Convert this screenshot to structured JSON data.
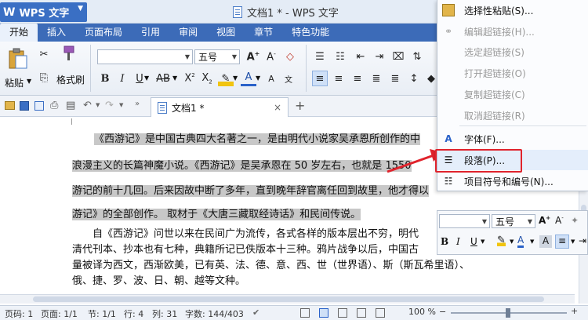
{
  "app": {
    "name": "WPS 文字",
    "doc_title": "文档1 * - WPS 文字"
  },
  "tabs": [
    "开始",
    "插入",
    "页面布局",
    "引用",
    "审阅",
    "视图",
    "章节",
    "特色功能"
  ],
  "ribbon": {
    "paste_label": "粘贴",
    "format_painter_label": "格式刷",
    "font_name": "",
    "font_size": "五号"
  },
  "doc_tab": {
    "label": "文档1 *"
  },
  "document": {
    "lines": [
      "《西游记》是中国古典四大名著之一，是由明代小说家吴承恩所创作的中",
      "浪漫主义的长篇神魔小说。《西游记》是吴承恩在 50 岁左右，也就是 1550",
      "游记的前十几回。后来因故中断了多年，直到晚年辞官离任回到故里，他才得以",
      "游记》的全部创作。 取材于《大唐三藏取经诗话》和民间传说。",
      "自《西游记》问世以来在民间广为流传，各式各样的版本层出不穷，明代",
      "清代刊本、抄本也有七种，典籍所记已佚版本十三种。鸦片战争以后，中国古",
      "量被译为西文，西渐欧美，已有英、法、德、意、西、世（世界语）、斯（斯瓦希里语）、",
      "俄、捷、罗、波、日、朝、越等文种。"
    ]
  },
  "context_menu": {
    "items": [
      {
        "label": "选择性粘贴(S)...",
        "disabled": false
      },
      {
        "label": "编辑超链接(H)...",
        "disabled": true
      },
      {
        "label": "选定超链接(S)",
        "disabled": true
      },
      {
        "label": "打开超链接(O)",
        "disabled": true
      },
      {
        "label": "复制超链接(C)",
        "disabled": true
      },
      {
        "label": "取消超链接(R)",
        "disabled": true
      },
      {
        "label": "字体(F)...",
        "disabled": false
      },
      {
        "label": "段落(P)...",
        "disabled": false
      },
      {
        "label": "项目符号和编号(N)...",
        "disabled": false
      }
    ]
  },
  "mini_toolbar": {
    "font_name": "",
    "font_size": "五号"
  },
  "status": {
    "page_num": "页码: 1",
    "pages": "页面: 1/1",
    "section": "节: 1/1",
    "row": "行: 4",
    "col": "列: 31",
    "words": "字数: 144/403",
    "zoom": "100 %"
  },
  "colors": {
    "tab_bar": "#3c6bb8",
    "app_button": "#3a6fc4",
    "highlight_box": "#e0232c",
    "arrow": "#e0232c",
    "selection": "#c8c8c8"
  }
}
